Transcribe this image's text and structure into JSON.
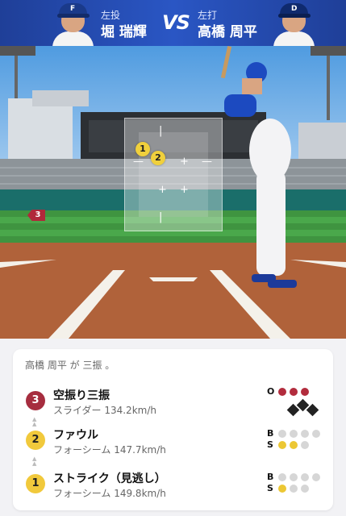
{
  "header": {
    "pitcher": {
      "hand": "左投",
      "name": "堀 瑞輝"
    },
    "vs": "VS",
    "batter": {
      "hand": "左打",
      "name": "高橋 周平"
    }
  },
  "field": {
    "pitch_markers": [
      "1",
      "2"
    ],
    "side_marker": "3"
  },
  "card": {
    "result_text": "高橋 周平 が 三振 。",
    "pitches": [
      {
        "number": "3",
        "event": "空振り三振",
        "detail": "スライダー 134.2km/h",
        "outs_label": "O",
        "outs": 3,
        "balls_label": "",
        "strikes_label": "",
        "balls": 0,
        "strikes": 0
      },
      {
        "number": "2",
        "event": "ファウル",
        "detail": "フォーシーム 147.7km/h",
        "balls_label": "B",
        "strikes_label": "S",
        "balls": 0,
        "strikes": 2
      },
      {
        "number": "1",
        "event": "ストライク（見逃し）",
        "detail": "フォーシーム 149.8km/h",
        "balls_label": "B",
        "strikes_label": "S",
        "balls": 0,
        "strikes": 1
      }
    ]
  },
  "colors": {
    "header_blue": "#2a56c4",
    "out_red": "#b22c3d",
    "strike_yellow": "#ecc734"
  }
}
